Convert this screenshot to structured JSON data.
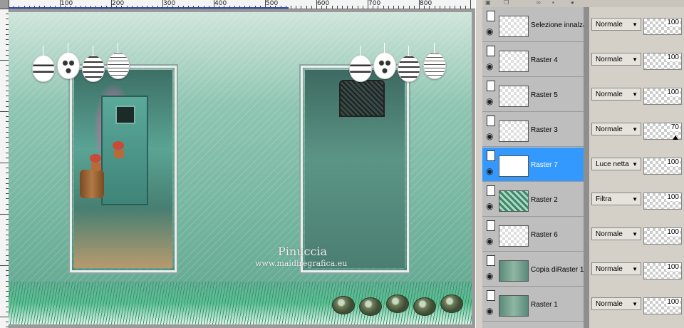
{
  "ruler": {
    "labels": [
      "100",
      "200",
      "300",
      "400",
      "500",
      "600",
      "700",
      "800"
    ]
  },
  "watermark": {
    "name": "Pinuccia",
    "url": "www.maidiregrafica.eu"
  },
  "layers": [
    {
      "name": "Selezione innalzat",
      "blend": "Normale",
      "opacity": "100",
      "selected": false
    },
    {
      "name": "Raster 4",
      "blend": "Normale",
      "opacity": "100",
      "selected": false
    },
    {
      "name": "Raster 5",
      "blend": "Normale",
      "opacity": "100",
      "selected": false
    },
    {
      "name": "Raster 3",
      "blend": "Normale",
      "opacity": "70",
      "selected": false
    },
    {
      "name": "Raster 7",
      "blend": "Luce netta",
      "opacity": "100",
      "selected": true
    },
    {
      "name": "Raster 2",
      "blend": "Filtra",
      "opacity": "100",
      "selected": false
    },
    {
      "name": "Raster 6",
      "blend": "Normale",
      "opacity": "100",
      "selected": false
    },
    {
      "name": "Copia diRaster 1",
      "blend": "Normale",
      "opacity": "100",
      "selected": false
    },
    {
      "name": "Raster 1",
      "blend": "Normale",
      "opacity": "100",
      "selected": false
    }
  ],
  "colors": {
    "selection": "#3399ff",
    "canvas_teal": "#79b8a3"
  }
}
